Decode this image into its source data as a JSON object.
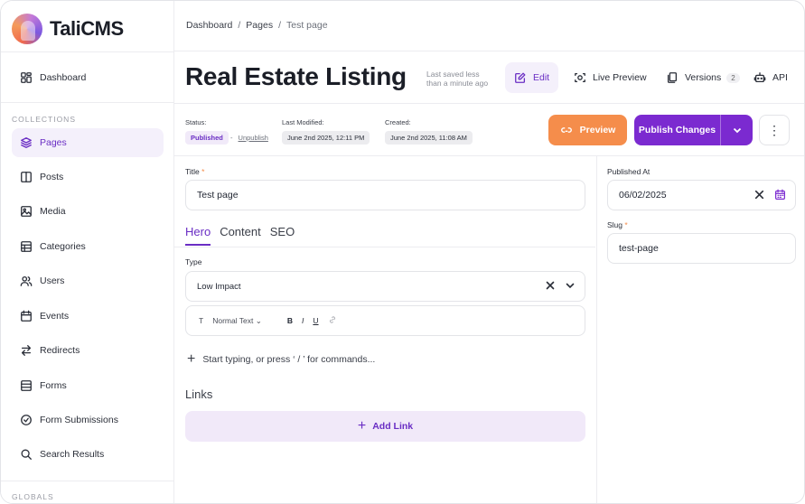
{
  "app": {
    "brand": "TaliCMS"
  },
  "sidebar": {
    "top_item": {
      "label": "Dashboard",
      "icon": "dashboard-icon"
    },
    "collections_label": "COLLECTIONS",
    "items": [
      {
        "label": "Pages",
        "icon": "layers-icon",
        "active": true
      },
      {
        "label": "Posts",
        "icon": "columns-icon"
      },
      {
        "label": "Media",
        "icon": "image-icon"
      },
      {
        "label": "Categories",
        "icon": "grid-icon"
      },
      {
        "label": "Users",
        "icon": "users-icon"
      },
      {
        "label": "Events",
        "icon": "calendar-icon"
      },
      {
        "label": "Redirects",
        "icon": "arrows-icon"
      },
      {
        "label": "Forms",
        "icon": "list-icon"
      },
      {
        "label": "Form Submissions",
        "icon": "check-circle-icon"
      },
      {
        "label": "Search Results",
        "icon": "search-icon"
      }
    ],
    "globals_label": "GLOBALS"
  },
  "breadcrumb": {
    "items": [
      "Dashboard",
      "Pages",
      "Test page"
    ],
    "sep": "/"
  },
  "header": {
    "title": "Real Estate Listing",
    "saved_line1": "Last saved less",
    "saved_line2": "than a minute ago",
    "edit_label": "Edit",
    "live_preview_label": "Live Preview",
    "versions_label": "Versions",
    "versions_count": "2",
    "api_label": "API"
  },
  "status": {
    "status_label": "Status:",
    "status_value": "Published",
    "unpublish_label": "Unpublish",
    "modified_label": "Last Modified:",
    "modified_value": "June 2nd 2025, 12:11 PM",
    "created_label": "Created:",
    "created_value": "June 2nd 2025, 11:08 AM",
    "preview_label": "Preview",
    "publish_label": "Publish Changes",
    "more_label": "⋮"
  },
  "form": {
    "title_label": "Title",
    "title_value": "Test page",
    "tabs": [
      "Hero",
      "Content",
      "SEO"
    ],
    "type_label": "Type",
    "type_value": "Low Impact",
    "toolbar": {
      "text_style": "Normal Text",
      "bold": "B",
      "italic": "I",
      "underline": "U"
    },
    "editor_placeholder": "Start typing, or press ‘ / ’ for commands...",
    "links_label": "Links",
    "add_link_label": "Add Link"
  },
  "side_panel": {
    "published_at_label": "Published At",
    "published_at_value": "06/02/2025",
    "slug_label": "Slug",
    "slug_value": "test-page"
  },
  "colors": {
    "accent": "#7b2ad0",
    "preview": "#f58d4b",
    "active_bg": "#f4f0fb"
  }
}
